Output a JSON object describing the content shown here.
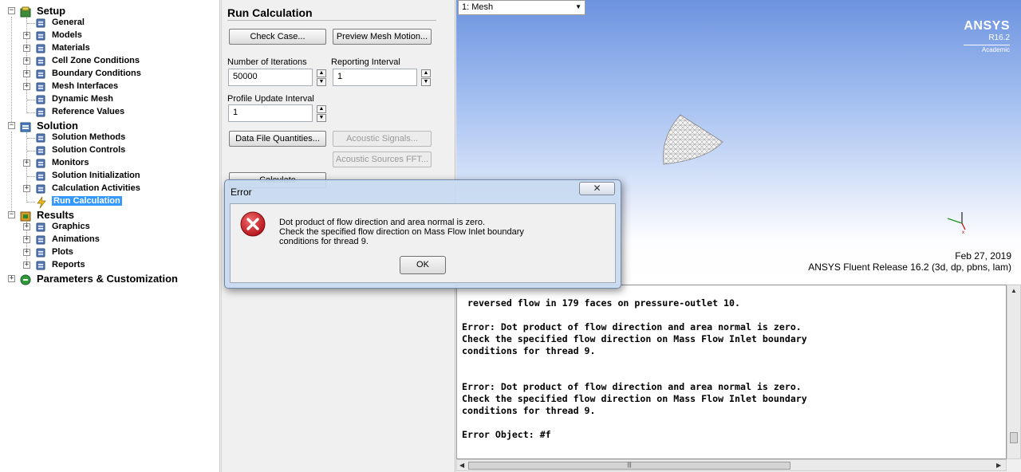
{
  "tree": {
    "items": [
      {
        "label": "Setup",
        "level": 0,
        "expander": "−",
        "icon": "setup-icon"
      },
      {
        "label": "General",
        "level": 1,
        "expander": "",
        "icon": "general-icon"
      },
      {
        "label": "Models",
        "level": 1,
        "expander": "+",
        "icon": "models-icon"
      },
      {
        "label": "Materials",
        "level": 1,
        "expander": "+",
        "icon": "materials-icon"
      },
      {
        "label": "Cell Zone Conditions",
        "level": 1,
        "expander": "+",
        "icon": "cell-zone-icon"
      },
      {
        "label": "Boundary Conditions",
        "level": 1,
        "expander": "+",
        "icon": "boundary-icon"
      },
      {
        "label": "Mesh Interfaces",
        "level": 1,
        "expander": "+",
        "icon": "mesh-interfaces-icon"
      },
      {
        "label": "Dynamic Mesh",
        "level": 1,
        "expander": "",
        "icon": "dynamic-mesh-icon"
      },
      {
        "label": "Reference Values",
        "level": 1,
        "expander": "",
        "icon": "reference-values-icon"
      },
      {
        "label": "Solution",
        "level": 0,
        "expander": "−",
        "icon": "solution-icon"
      },
      {
        "label": "Solution Methods",
        "level": 1,
        "expander": "",
        "icon": "solution-methods-icon"
      },
      {
        "label": "Solution Controls",
        "level": 1,
        "expander": "",
        "icon": "solution-controls-icon"
      },
      {
        "label": "Monitors",
        "level": 1,
        "expander": "+",
        "icon": "monitors-icon"
      },
      {
        "label": "Solution Initialization",
        "level": 1,
        "expander": "",
        "icon": "initialization-icon"
      },
      {
        "label": "Calculation Activities",
        "level": 1,
        "expander": "+",
        "icon": "calculation-activities-icon"
      },
      {
        "label": "Run Calculation",
        "level": 1,
        "expander": "",
        "icon": "run-calculation-icon",
        "selected": true
      },
      {
        "label": "Results",
        "level": 0,
        "expander": "−",
        "icon": "results-icon"
      },
      {
        "label": "Graphics",
        "level": 1,
        "expander": "+",
        "icon": "graphics-icon"
      },
      {
        "label": "Animations",
        "level": 1,
        "expander": "+",
        "icon": "animations-icon"
      },
      {
        "label": "Plots",
        "level": 1,
        "expander": "+",
        "icon": "plots-icon"
      },
      {
        "label": "Reports",
        "level": 1,
        "expander": "+",
        "icon": "reports-icon"
      },
      {
        "label": "Parameters & Customization",
        "level": 0,
        "expander": "+",
        "icon": "parameters-icon"
      }
    ]
  },
  "task": {
    "title": "Run Calculation",
    "check_case": "Check Case...",
    "preview_mesh_motion": "Preview Mesh Motion...",
    "iterations_label": "Number of Iterations",
    "iterations_value": "50000",
    "reporting_label": "Reporting Interval",
    "reporting_value": "1",
    "profile_label": "Profile Update Interval",
    "profile_value": "1",
    "data_file_quantities": "Data File Quantities...",
    "acoustic_signals": "Acoustic Signals...",
    "acoustic_sources_fft": "Acoustic Sources FFT...",
    "calculate": "Calculate"
  },
  "graphics": {
    "view_select": "1: Mesh",
    "logo_name": "ANSYS",
    "logo_version": "R16.2",
    "logo_edition": "Academic",
    "date": "Feb 27, 2019",
    "release": "ANSYS Fluent Release 16.2 (3d, dp, pbns, lam)"
  },
  "console": {
    "lines": [
      " reversed flow in 179 faces on pressure-outlet 10.",
      "",
      "Error: Dot product of flow direction and area normal is zero.",
      "Check the specified flow direction on Mass Flow Inlet boundary",
      "conditions for thread 9.",
      "",
      "",
      "Error: Dot product of flow direction and area normal is zero.",
      "Check the specified flow direction on Mass Flow Inlet boundary",
      "conditions for thread 9.",
      "",
      "Error Object: #f"
    ]
  },
  "dialog": {
    "title": "Error",
    "close_glyph": "✕",
    "message_lines": [
      "Dot product of flow direction and area normal is zero.",
      "Check the specified flow direction on Mass Flow Inlet boundary",
      "conditions for thread 9."
    ],
    "ok_label": "OK",
    "error_color": "#c4161c"
  }
}
